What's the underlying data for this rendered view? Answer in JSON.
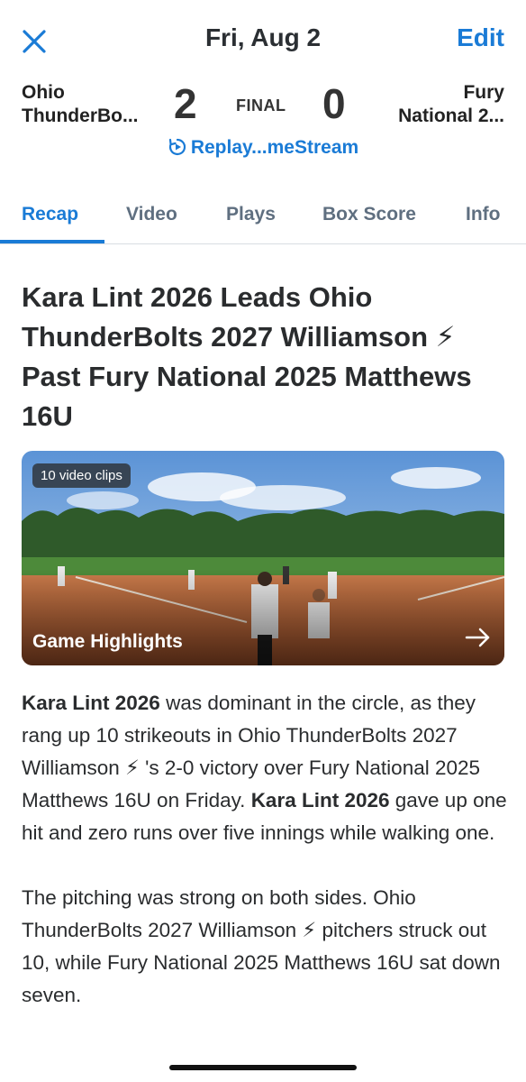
{
  "header": {
    "date": "Fri, Aug 2",
    "edit_label": "Edit"
  },
  "game": {
    "home_team_line1": "Ohio",
    "home_team_line2": "ThunderBo...",
    "away_team_line1": "Fury",
    "away_team_line2": "National 2...",
    "home_score": "2",
    "away_score": "0",
    "status": "FINAL",
    "replay_label": "Replay...meStream"
  },
  "tabs": [
    {
      "label": "Recap",
      "active": true
    },
    {
      "label": "Video",
      "active": false
    },
    {
      "label": "Plays",
      "active": false
    },
    {
      "label": "Box Score",
      "active": false
    },
    {
      "label": "Info",
      "active": false
    }
  ],
  "recap": {
    "headline": "Kara Lint 2026 Leads Ohio ThunderBolts 2027 Williamson ⚡ Past Fury National 2025 Matthews 16U",
    "video": {
      "badge": "10 video clips",
      "title": "Game Highlights"
    },
    "paragraph1": {
      "bold1": "Kara Lint 2026",
      "text1": " was dominant in the circle, as they rang up 10 strikeouts in Ohio ThunderBolts 2027 Williamson ⚡ 's 2-0 victory over Fury National 2025 Matthews 16U on Friday. ",
      "bold2": "Kara Lint 2026",
      "text2": " gave up one hit and zero runs over five innings while walking one."
    },
    "paragraph2": "The pitching was strong on both sides. Ohio ThunderBolts 2027 Williamson ⚡ pitchers struck out 10, while Fury National 2025 Matthews 16U sat down seven."
  },
  "colors": {
    "accent": "#1a7bd6",
    "tab_inactive": "#5f6f80",
    "text": "#2a2c2e"
  }
}
